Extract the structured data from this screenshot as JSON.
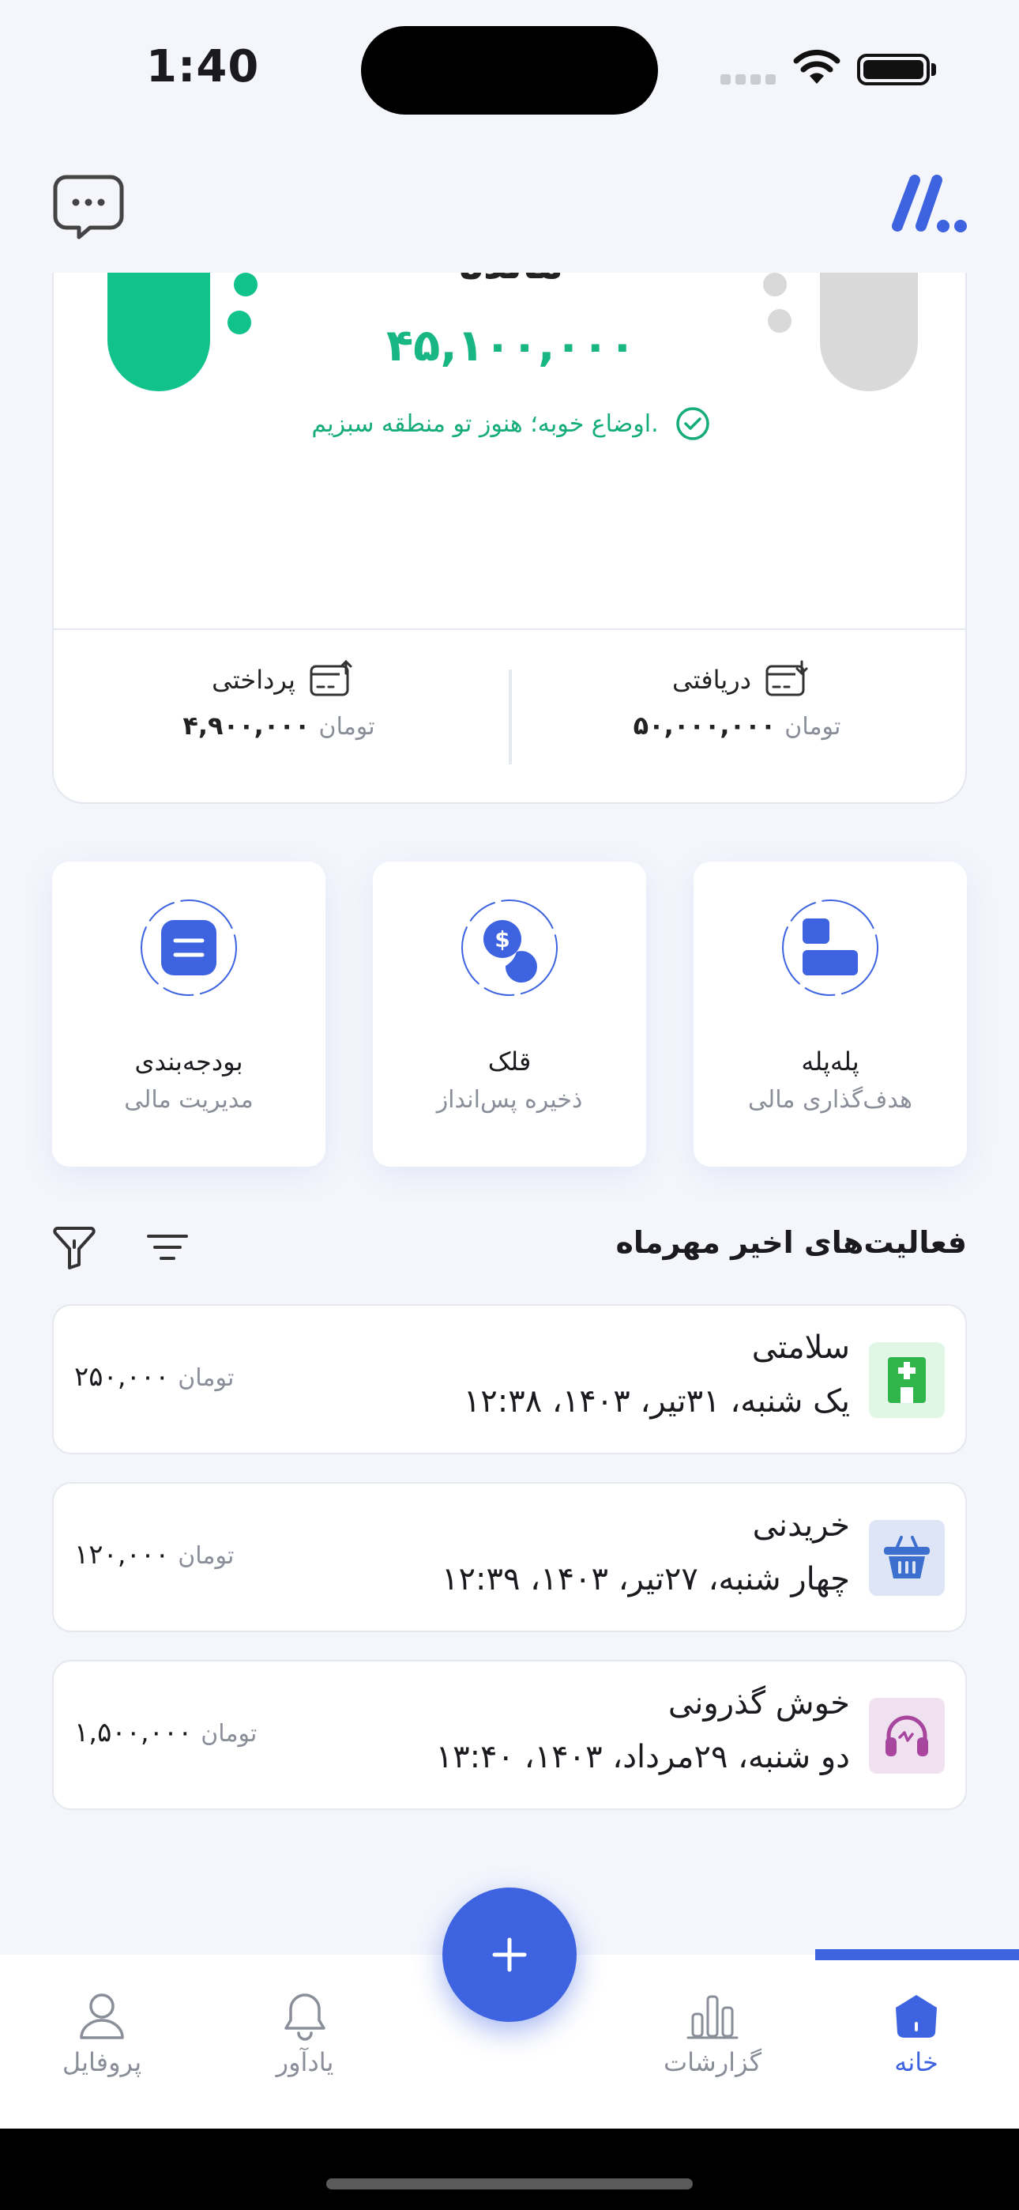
{
  "status_bar": {
    "time": "1:40"
  },
  "balance_card": {
    "title": "مانده",
    "amount": "۴۵,۱۰۰,۰۰۰",
    "status_message": "اوضاع خوبه؛ هنوز تو منطقه سبزیم.",
    "received": {
      "label": "دریافتی",
      "amount": "۵۰,۰۰۰,۰۰۰",
      "unit": "تومان"
    },
    "paid": {
      "label": "پرداختی",
      "amount": "۴,۹۰۰,۰۰۰",
      "unit": "تومان"
    },
    "colors": {
      "accent_green": "#17b682"
    }
  },
  "tiles": [
    {
      "title": "پله‌پله",
      "subtitle": "هدف‌گذاری مالی",
      "icon": "goal-icon"
    },
    {
      "title": "قلک",
      "subtitle": "ذخیره پس‌انداز",
      "icon": "piggy-bank-icon"
    },
    {
      "title": "بودجه‌بندی",
      "subtitle": "مدیریت مالی",
      "icon": "budget-icon"
    }
  ],
  "activities": {
    "title": "فعالیت‌های اخیر مهرماه",
    "items": [
      {
        "title": "سلامتی",
        "date": "یک شنبه، ۳۱تیر، ۱۴۰۳، ۱۲:۳۸",
        "amount": "۲۵۰,۰۰۰",
        "unit": "تومان",
        "icon": "hospital-icon",
        "icon_bg": "#e2f6e6",
        "icon_color": "#2fb54a"
      },
      {
        "title": "خریدنی",
        "date": "چهار شنبه، ۲۷تیر، ۱۴۰۳، ۱۲:۳۹",
        "amount": "۱۲۰,۰۰۰",
        "unit": "تومان",
        "icon": "basket-icon",
        "icon_bg": "#dde5f6",
        "icon_color": "#3d6fcf"
      },
      {
        "title": "خوش گذرونی",
        "date": "دو شنبه، ۲۹مرداد، ۱۴۰۳، ۱۳:۴۰",
        "amount": "۱,۵۰۰,۰۰۰",
        "unit": "تومان",
        "icon": "headphones-icon",
        "icon_bg": "#f0e1f1",
        "icon_color": "#a7459f"
      }
    ]
  },
  "bottom_nav": {
    "items": [
      {
        "label": "خانه",
        "icon": "home-icon",
        "active": true
      },
      {
        "label": "گزارشات",
        "icon": "bar-chart-icon",
        "active": false
      },
      {
        "label": "یادآور",
        "icon": "bell-icon",
        "active": false
      },
      {
        "label": "پروفایل",
        "icon": "profile-icon",
        "active": false
      }
    ],
    "fab": "+",
    "colors": {
      "primary": "#3d63e0",
      "inactive": "#8a8e99"
    }
  }
}
